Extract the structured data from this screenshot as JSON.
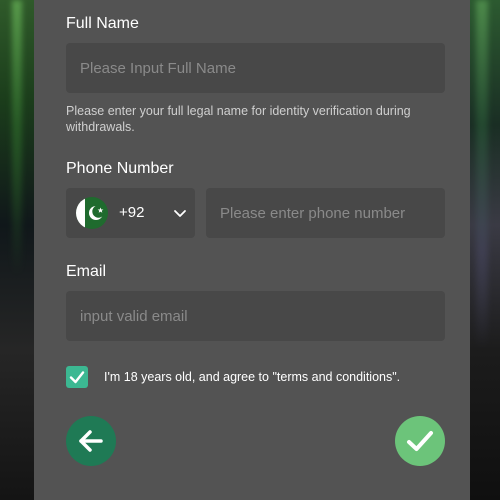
{
  "form": {
    "full_name": {
      "label": "Full Name",
      "placeholder": "Please Input Full Name",
      "value": "",
      "hint": "Please enter your full legal name for identity verification during withdrawals."
    },
    "phone": {
      "label": "Phone Number",
      "country_flag": "pakistan-flag-icon",
      "dial_code": "+92",
      "placeholder": "Please enter phone number",
      "value": ""
    },
    "email": {
      "label": "Email",
      "placeholder": "input valid email",
      "value": ""
    },
    "agreement": {
      "checked": true,
      "text": "I'm 18 years old, and agree to \"terms and conditions\"."
    }
  },
  "actions": {
    "back_icon": "arrow-left-icon",
    "submit_icon": "checkmark-icon"
  },
  "colors": {
    "panel_bg": "#535353",
    "input_bg": "#484848",
    "checkbox": "#3cb892",
    "back_button": "#1f7a55",
    "submit_button": "#6cc47a"
  }
}
